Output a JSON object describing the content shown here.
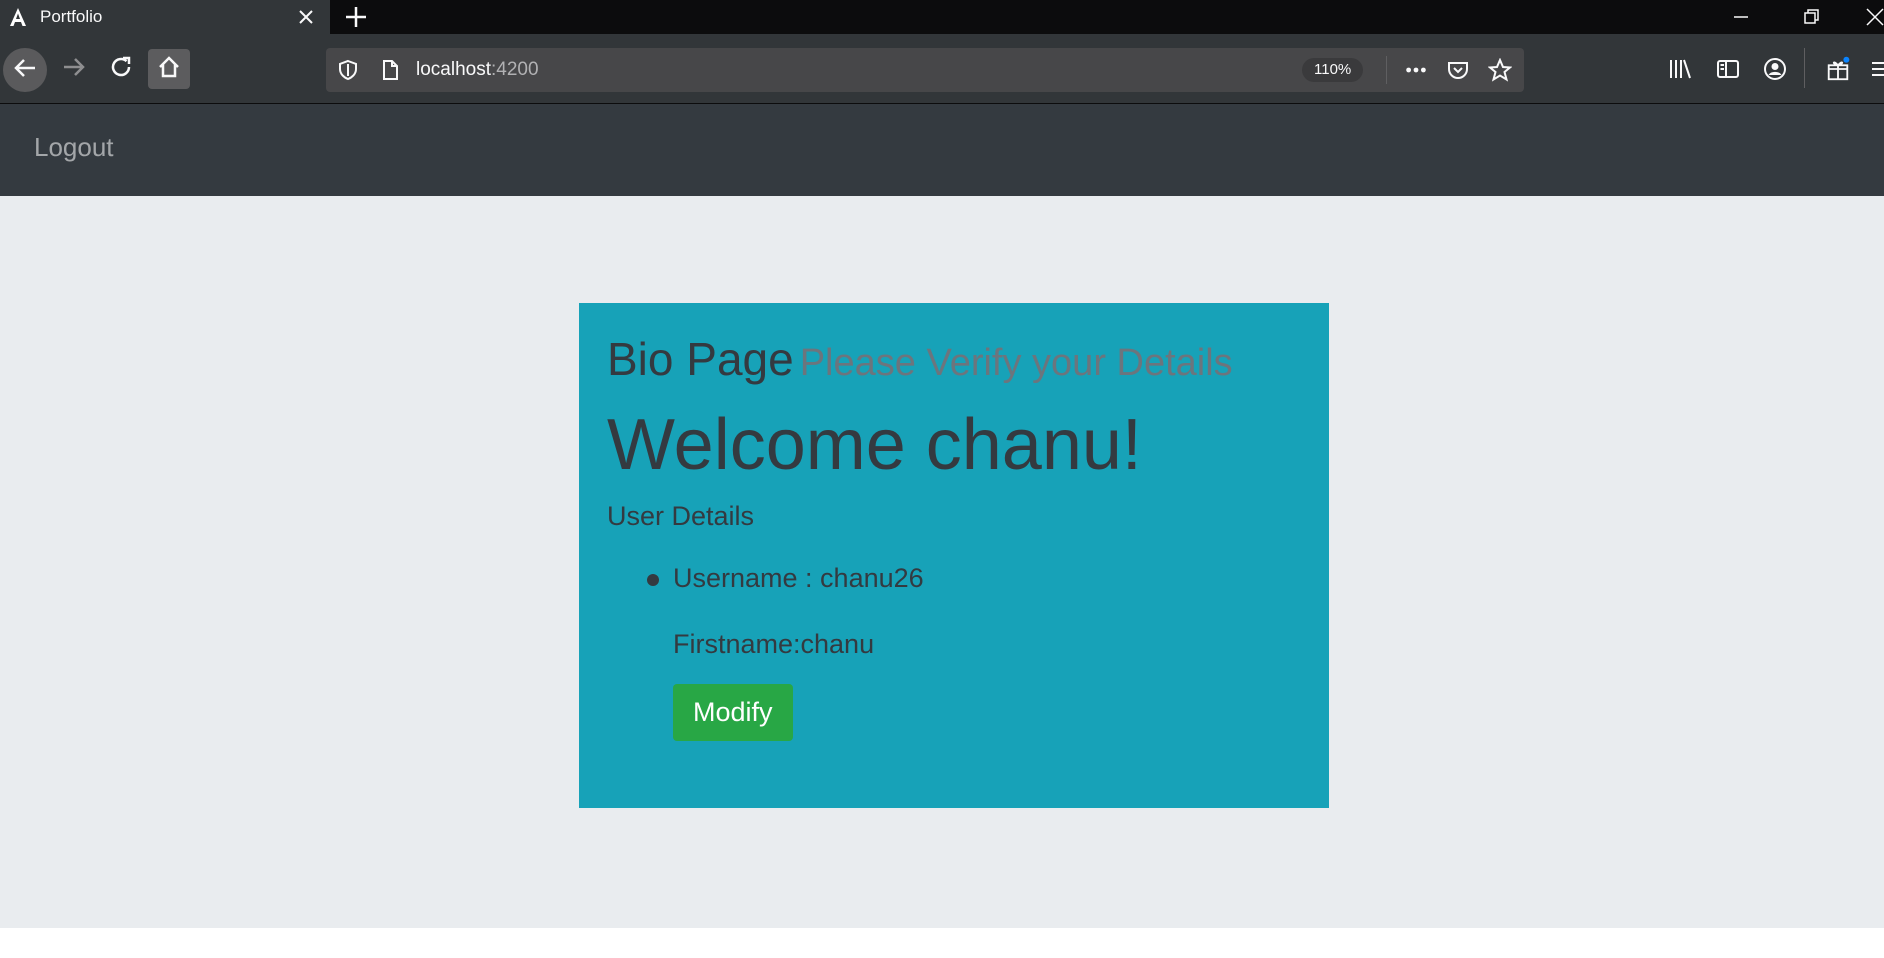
{
  "browser": {
    "tab_title": "Portfolio",
    "url_host": "localhost",
    "url_port": ":4200",
    "zoom": "110%"
  },
  "header": {
    "logout_label": "Logout"
  },
  "bio": {
    "heading": "Bio Page",
    "subheading": "Please Verify your Details",
    "welcome": "Welcome chanu!",
    "details_title": "User Details",
    "username_line": "Username : chanu26",
    "firstname_line": "Firstname:chanu",
    "modify_label": "Modify"
  },
  "colors": {
    "header_bg": "#343a40",
    "page_bg": "#e9ecef",
    "card_bg": "#17a2b8",
    "button_bg": "#28a745"
  }
}
